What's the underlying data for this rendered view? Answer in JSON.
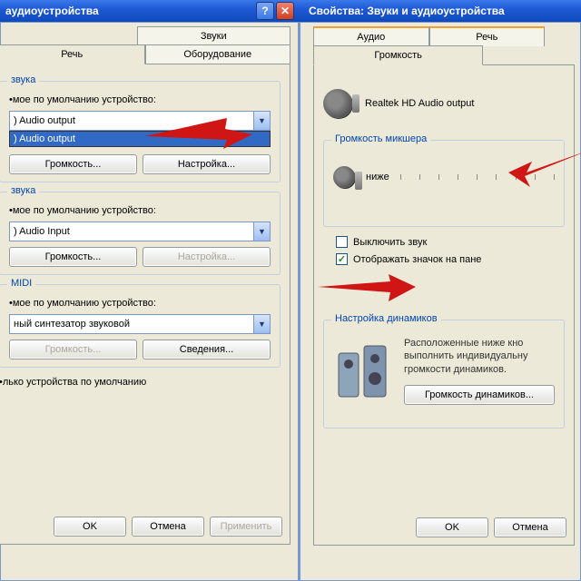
{
  "left": {
    "title": "аудиоустройства",
    "tabs_back": [
      "Звуки"
    ],
    "tabs_front": [
      "Речь",
      "Оборудование"
    ],
    "group1": {
      "title": "звука",
      "label": "•мое по умолчанию устройство:",
      "combo_value": ") Audio output",
      "dropdown_item": ") Audio output",
      "btn_vol": "Громкость...",
      "btn_cfg": "Настройка..."
    },
    "group2": {
      "title": "звука",
      "label": "•мое по умолчанию устройство:",
      "combo_value": ") Audio Input",
      "btn_vol": "Громкость...",
      "btn_cfg": "Настройка..."
    },
    "group3": {
      "title": "MIDI",
      "label": "•мое по умолчанию устройство:",
      "combo_value": "ный синтезатор звуковой",
      "btn_vol": "Громкость...",
      "btn_info": "Сведения..."
    },
    "only_default": "•лько устройства по умолчанию",
    "ok": "OK",
    "cancel": "Отмена",
    "apply": "Применить"
  },
  "right": {
    "title": "Свойства: Звуки и аудиоустройства",
    "tabs_back": [
      "Аудио",
      "Речь"
    ],
    "tab_active": "Громкость",
    "device_name": "Realtek HD Audio output",
    "mixer": {
      "title": "Громкость микшера",
      "low": "ниже"
    },
    "mute": "Выключить звук",
    "tray": "Отображать значок на пане",
    "speakers": {
      "title": "Настройка динамиков",
      "desc": "Расположенные ниже кно\nвыполнить индивидуальну\nгромкости динамиков.",
      "btn": "Громкость динамиков..."
    },
    "ok": "OK",
    "cancel": "Отмена"
  }
}
